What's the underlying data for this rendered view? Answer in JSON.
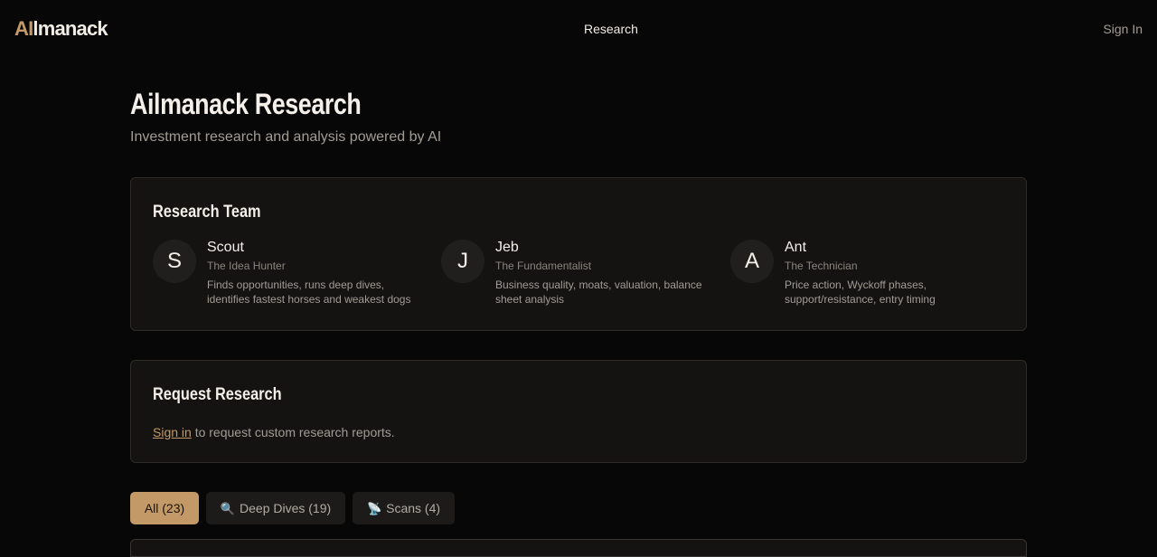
{
  "nav": {
    "logo_accent": "AI",
    "logo_rest": "lmanack",
    "research_link": "Research",
    "signin_link": "Sign In"
  },
  "header": {
    "title": "Ailmanack Research",
    "subtitle": "Investment research and analysis powered by AI"
  },
  "team": {
    "title": "Research Team",
    "members": [
      {
        "initial": "S",
        "name": "Scout",
        "role": "The Idea Hunter",
        "description": "Finds opportunities, runs deep dives, identifies fastest horses and weakest dogs"
      },
      {
        "initial": "J",
        "name": "Jeb",
        "role": "The Fundamentalist",
        "description": "Business quality, moats, valuation, balance sheet analysis"
      },
      {
        "initial": "A",
        "name": "Ant",
        "role": "The Technician",
        "description": "Price action, Wyckoff phases, support/resistance, entry timing"
      }
    ]
  },
  "request": {
    "title": "Request Research",
    "signin_link": "Sign in",
    "text": " to request custom research reports."
  },
  "tabs": [
    {
      "label": "All (23)",
      "icon": "",
      "selected": true
    },
    {
      "label": "Deep Dives (19)",
      "icon": "🔍",
      "icon_name": "magnifier-icon",
      "selected": false
    },
    {
      "label": "Scans (4)",
      "icon": "📡",
      "icon_name": "satellite-dish-icon",
      "selected": false
    }
  ],
  "colors": {
    "accent": "#c39a67",
    "background": "#080707",
    "card": "#141312",
    "text_muted": "#a29c94"
  }
}
